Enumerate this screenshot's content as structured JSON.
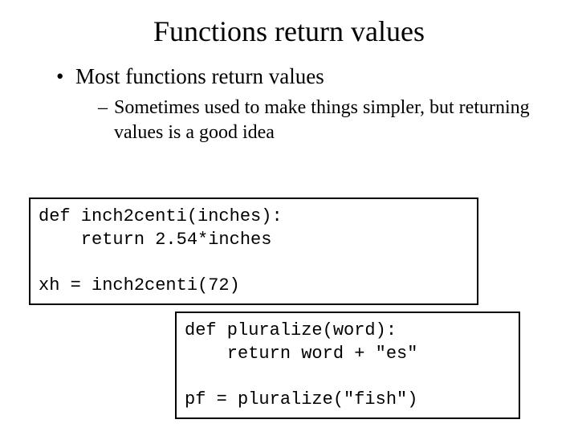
{
  "title": "Functions return values",
  "bullet": "Most functions return values",
  "subbullet": "Sometimes used to make things simpler, but returning values is a good idea",
  "code1": "def inch2centi(inches):\n    return 2.54*inches\n\nxh = inch2centi(72)",
  "code2": "def pluralize(word):\n    return word + \"es\"\n\npf = pluralize(\"fish\")"
}
